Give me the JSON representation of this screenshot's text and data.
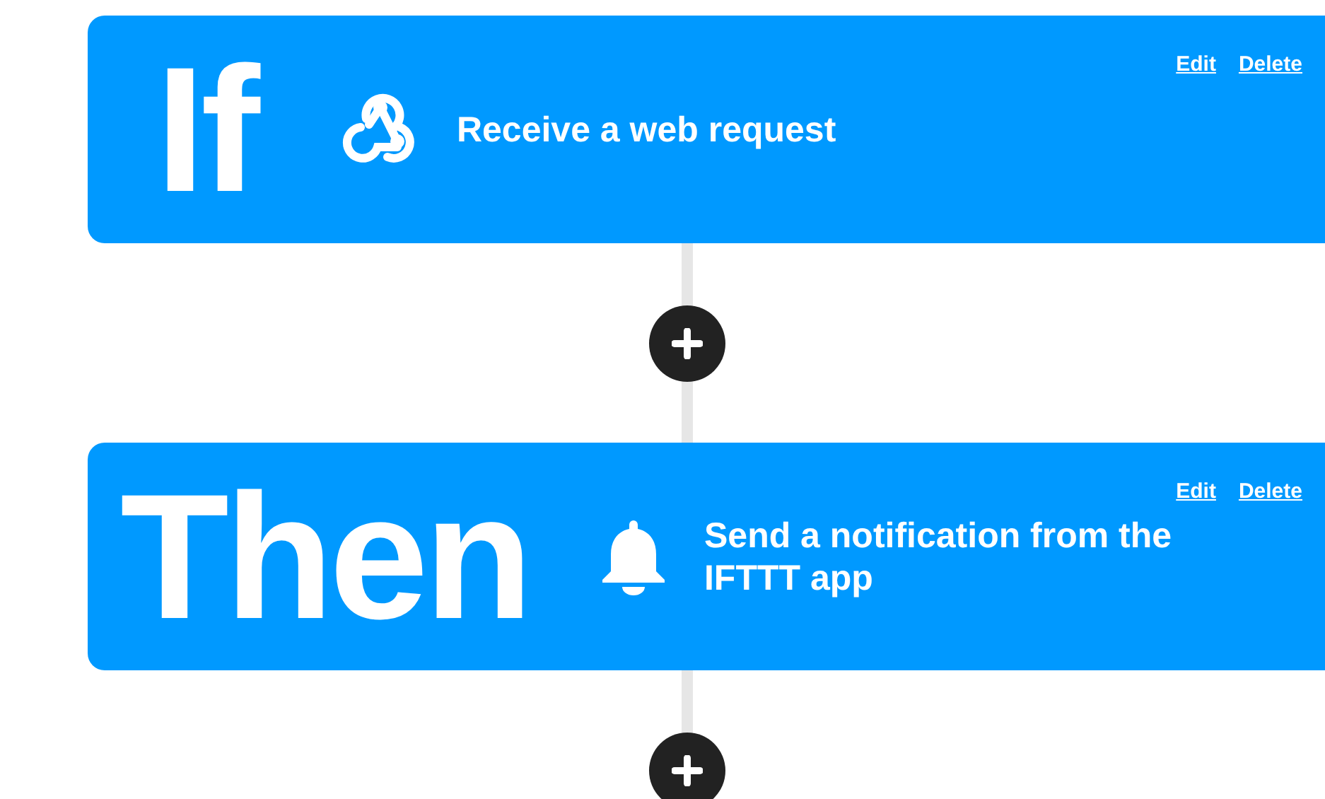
{
  "steps": [
    {
      "kind": "trigger",
      "keyword": "If",
      "title": "Receive a web request",
      "links": [
        "Edit",
        "Delete"
      ]
    },
    {
      "kind": "action",
      "keyword": "Then",
      "title": "Send a notification from the IFTTT app",
      "links": [
        "Edit",
        "Delete"
      ]
    }
  ]
}
